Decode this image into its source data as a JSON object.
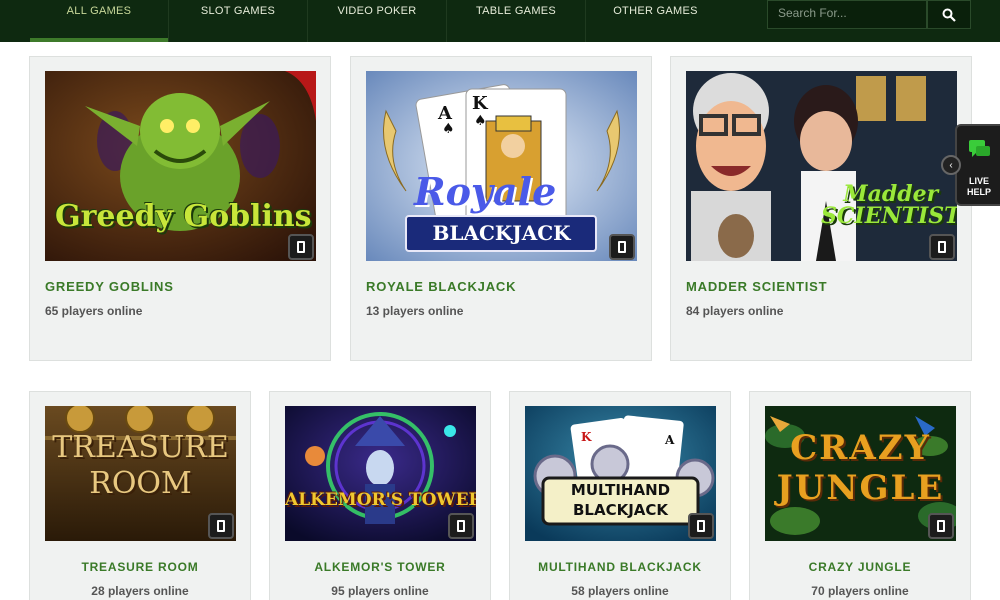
{
  "nav": {
    "items": [
      "ALL GAMES",
      "SLOT GAMES",
      "VIDEO POKER",
      "TABLE GAMES",
      "OTHER GAMES"
    ],
    "search_placeholder": "Search For..."
  },
  "live_help": {
    "label_line1": "LIVE",
    "label_line2": "HELP"
  },
  "games": [
    {
      "title": "GREEDY GOBLINS",
      "players": "65 players online",
      "art_text_1": "Greedy Goblins"
    },
    {
      "title": "ROYALE BLACKJACK",
      "players": "13 players online",
      "art_text_1": "Royale",
      "art_text_2": "BLACKJACK"
    },
    {
      "title": "MADDER SCIENTIST",
      "players": "84 players online",
      "art_text_1": "Madder",
      "art_text_2": "SCIENTIST"
    },
    {
      "title": "TREASURE ROOM",
      "players": "28 players online",
      "art_text_1": "TREASURE",
      "art_text_2": "ROOM"
    },
    {
      "title": "ALKEMOR'S TOWER",
      "players": "95 players online",
      "art_text_1": "ALKEMOR'S TOWER"
    },
    {
      "title": "MULTIHAND BLACKJACK",
      "players": "58 players online",
      "art_text_1": "MULTIHAND",
      "art_text_2": "BLACKJACK"
    },
    {
      "title": "CRAZY JUNGLE",
      "players": "70 players online",
      "art_text_1": "CRAZY",
      "art_text_2": "JUNGLE"
    }
  ]
}
